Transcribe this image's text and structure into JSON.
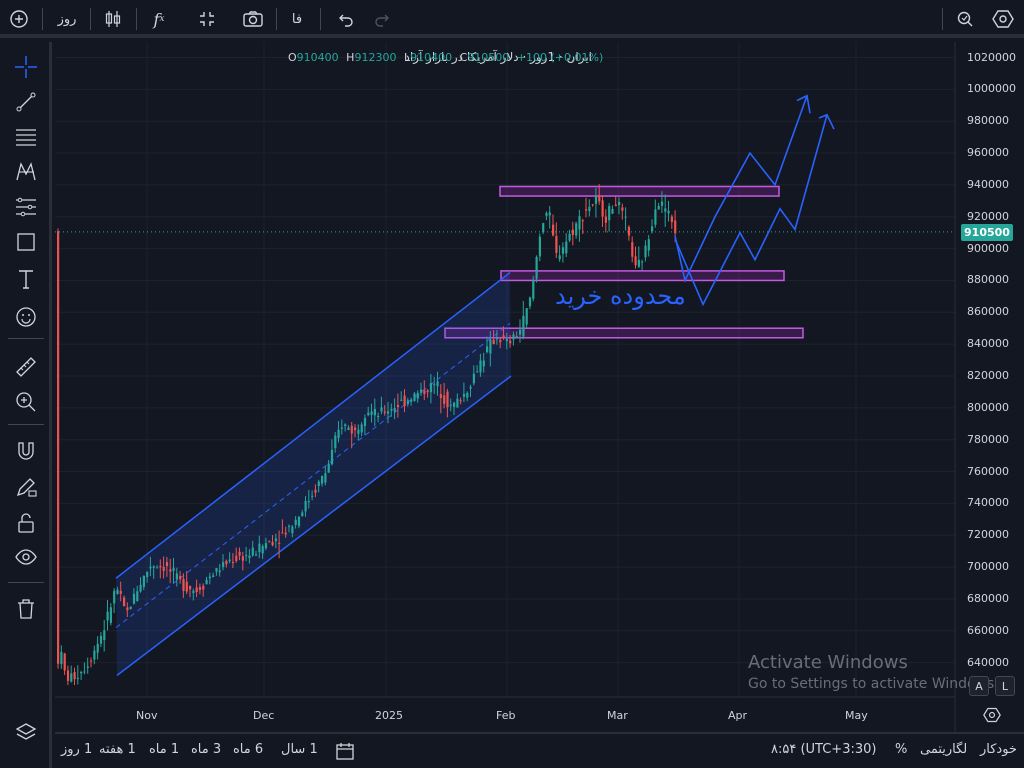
{
  "toolbar": {
    "interval_label": "روز",
    "fa_label": "فا",
    "fx_label": "f",
    "fx_sub": "x"
  },
  "legend": {
    "symbol": "ایران · 1روز · دلار آمریکا در بازار آزاد",
    "o_label": "O",
    "o_value": "910400",
    "h_label": "H",
    "h_value": "912300",
    "l_label": "L",
    "l_value": "910400",
    "c_label": "C",
    "c_value": "910500",
    "change": "+100 (+0.01%)"
  },
  "price_axis": {
    "ticks": [
      "1020000",
      "1000000",
      "980000",
      "960000",
      "940000",
      "920000",
      "900000",
      "880000",
      "860000",
      "840000",
      "820000",
      "800000",
      "780000",
      "760000",
      "740000",
      "720000",
      "700000",
      "680000",
      "660000",
      "640000"
    ],
    "last_price": "910500",
    "last_price_color": "#26a69a"
  },
  "time_axis": {
    "ticks": [
      "Nov",
      "Dec",
      "2025",
      "Feb",
      "Mar",
      "Apr",
      "May"
    ]
  },
  "annotation": {
    "text": "محدوده خرید",
    "color": "#2962ff"
  },
  "watermark": {
    "line1": "Activate Windows",
    "line2": "Go to Settings to activate Windows."
  },
  "axis_buttons": {
    "auto": "A",
    "log": "L"
  },
  "bottom": {
    "ranges": [
      "1 روز",
      "1 هفته",
      "1 ماه",
      "3 ماه",
      "6 ماه",
      "1 سال"
    ],
    "time": "۸:۵۴ (UTC+3:30)",
    "percent": "%",
    "log": "لگاریتمی",
    "auto": "خودکار"
  },
  "colors": {
    "up": "#26a69a",
    "down": "#ef5350",
    "channel": "#2962ff",
    "zone": "#9c27b0"
  }
}
